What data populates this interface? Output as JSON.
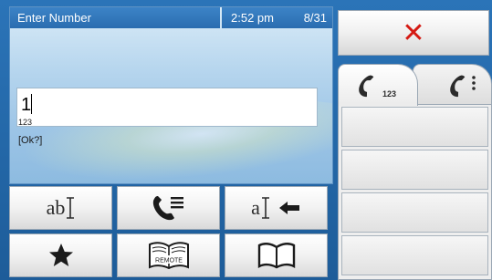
{
  "header": {
    "title": "Enter Number",
    "time": "2:52 pm",
    "date": "8/31"
  },
  "entry": {
    "value": "1",
    "input_mode": "123",
    "hint": "[Ok?]"
  },
  "keypad": {
    "rows": [
      [
        {
          "name": "ab-input-mode-button",
          "label": "ab",
          "icon": "text-cursor-icon"
        },
        {
          "name": "call-list-button",
          "icon": "phone-list-icon"
        },
        {
          "name": "backspace-button",
          "label": "a",
          "icon": "backspace-arrow-icon"
        }
      ],
      [
        {
          "name": "favorites-button",
          "icon": "star-icon"
        },
        {
          "name": "remote-phonebook-button",
          "label": "REMOTE",
          "icon": "remote-book-icon"
        },
        {
          "name": "phonebook-button",
          "icon": "open-book-icon"
        }
      ]
    ]
  },
  "right_panel": {
    "close_icon": "close-icon",
    "tabs": [
      {
        "name": "contacts-tab",
        "icon": "phone-contacts-icon",
        "badge": "123"
      },
      {
        "name": "recent-calls-tab",
        "icon": "phone-recent-icon"
      }
    ],
    "list_items": [
      "",
      "",
      "",
      ""
    ]
  },
  "colors": {
    "background": "#1f5f9c",
    "title_bar": "#2a6db0",
    "close_red": "#d51a13",
    "key_text": "#2b2b2b"
  }
}
